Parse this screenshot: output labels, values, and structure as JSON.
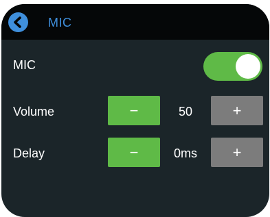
{
  "header": {
    "title": "MIC",
    "back_icon": "chevron-left-icon"
  },
  "mic": {
    "label": "MIC",
    "enabled": true
  },
  "volume": {
    "label": "Volume",
    "value": "50",
    "minus_label": "−",
    "plus_label": "+"
  },
  "delay": {
    "label": "Delay",
    "value": "0ms",
    "minus_label": "−",
    "plus_label": "+"
  },
  "colors": {
    "accent": "#3f8fdc",
    "on": "#5fba47",
    "neutral": "#7c7c7c",
    "background": "#1b2529",
    "header": "#050708"
  }
}
